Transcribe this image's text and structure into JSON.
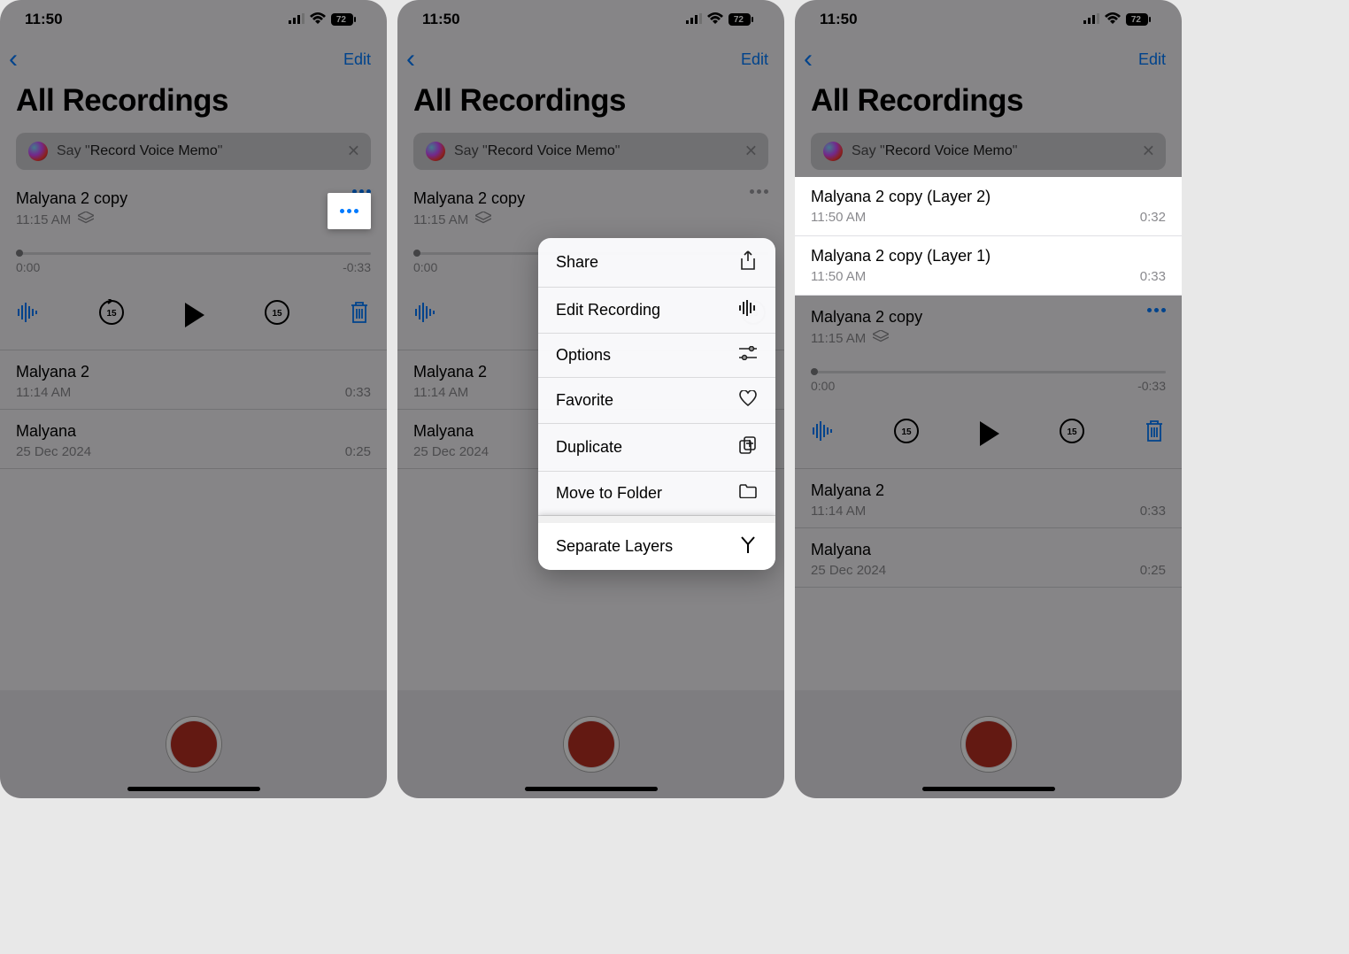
{
  "status": {
    "time": "11:50",
    "battery": "72"
  },
  "nav": {
    "edit": "Edit"
  },
  "header": {
    "title": "All Recordings"
  },
  "siri": {
    "prefix": "Say \"",
    "command": "Record Voice Memo",
    "suffix": "\""
  },
  "screen1": {
    "expanded": {
      "title": "Malyana 2 copy",
      "time": "11:15 AM",
      "scrub_start": "0:00",
      "scrub_end": "-0:33"
    },
    "items": [
      {
        "title": "Malyana 2",
        "sub": "11:14 AM",
        "dur": "0:33"
      },
      {
        "title": "Malyana",
        "sub": "25 Dec 2024",
        "dur": "0:25"
      }
    ]
  },
  "screen2": {
    "expanded": {
      "title": "Malyana 2 copy",
      "time": "11:15 AM",
      "scrub_start": "0:00"
    },
    "menu": [
      {
        "label": "Share",
        "icon": "share"
      },
      {
        "label": "Edit Recording",
        "icon": "waveform"
      },
      {
        "label": "Options",
        "icon": "sliders"
      },
      {
        "label": "Favorite",
        "icon": "heart"
      },
      {
        "label": "Duplicate",
        "icon": "duplicate"
      },
      {
        "label": "Move to Folder",
        "icon": "folder"
      },
      {
        "label": "Separate Layers",
        "icon": "fork"
      }
    ],
    "items": [
      {
        "title": "Malyana 2",
        "sub": "11:14 AM"
      },
      {
        "title": "Malyana",
        "sub": "25 Dec 2024"
      }
    ]
  },
  "screen3": {
    "layers": [
      {
        "title": "Malyana 2 copy (Layer 2)",
        "sub": "11:50 AM",
        "dur": "0:32"
      },
      {
        "title": "Malyana 2 copy (Layer 1)",
        "sub": "11:50 AM",
        "dur": "0:33"
      }
    ],
    "expanded": {
      "title": "Malyana 2 copy",
      "time": "11:15 AM",
      "scrub_start": "0:00",
      "scrub_end": "-0:33"
    },
    "items": [
      {
        "title": "Malyana 2",
        "sub": "11:14 AM",
        "dur": "0:33"
      },
      {
        "title": "Malyana",
        "sub": "25 Dec 2024",
        "dur": "0:25"
      }
    ]
  }
}
